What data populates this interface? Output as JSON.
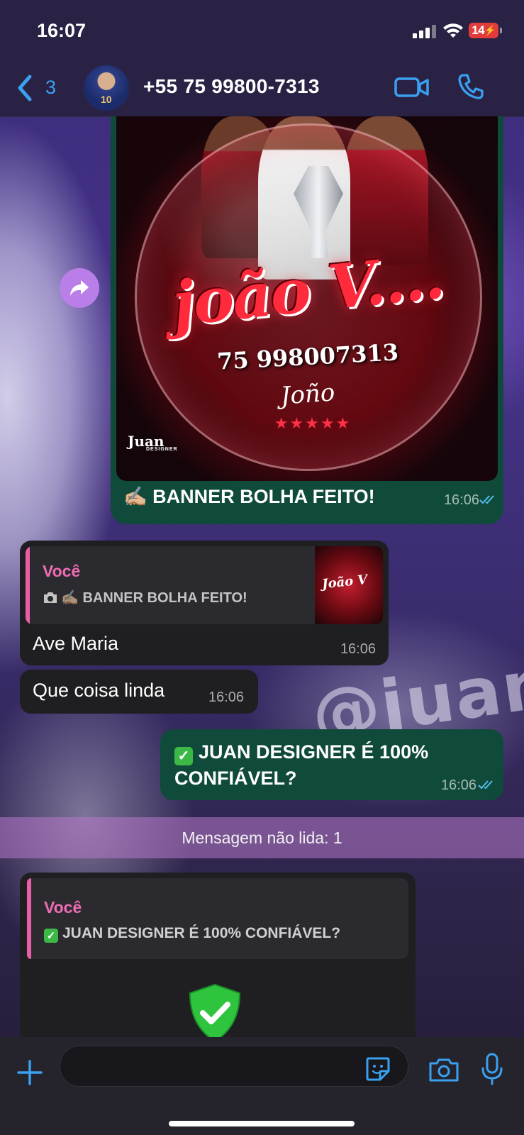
{
  "status_bar": {
    "time": "16:07",
    "battery": "14"
  },
  "header": {
    "back_count": "3",
    "contact_name": "+55 75 99800-7313"
  },
  "wallpaper": {
    "text": "@juan"
  },
  "image_message": {
    "banner_name": "joão V....",
    "banner_phone": "75 998007313",
    "banner_signature": "Joño",
    "banner_stars": "★★★★★",
    "banner_logo": "Juan",
    "banner_logo_sub": "DESIGNER",
    "caption_emoji": "✍🏼",
    "caption": "BANNER BOLHA FEITO!",
    "time": "16:06"
  },
  "reply_message": {
    "quoted_author": "Você",
    "quoted_text": "✍🏼 BANNER BOLHA FEITO!",
    "body": "Ave Maria",
    "time": "16:06"
  },
  "incoming_message": {
    "body": "Que coisa linda",
    "time": "16:06"
  },
  "outgoing_message": {
    "body": "JUAN DESIGNER É 100% CONFIÁVEL?",
    "time": "16:06"
  },
  "unread_divider": "Mensagem não lida: 1",
  "bottom_message": {
    "quoted_author": "Você",
    "quoted_text": "JUAN DESIGNER É 100% CONFIÁVEL?"
  },
  "input_bar": {
    "placeholder": ""
  },
  "colors": {
    "outgoing_bubble": "#0f4a3b",
    "incoming_bubble": "#1f1f22",
    "accent_blue": "#3aa0f0",
    "quote_author": "#ee6cb4"
  },
  "icons": [
    "back-chevron-icon",
    "video-call-icon",
    "phone-icon",
    "forward-icon",
    "double-check-icon",
    "camera-icon",
    "shield-check-icon",
    "plus-icon",
    "sticker-icon",
    "microphone-icon"
  ]
}
